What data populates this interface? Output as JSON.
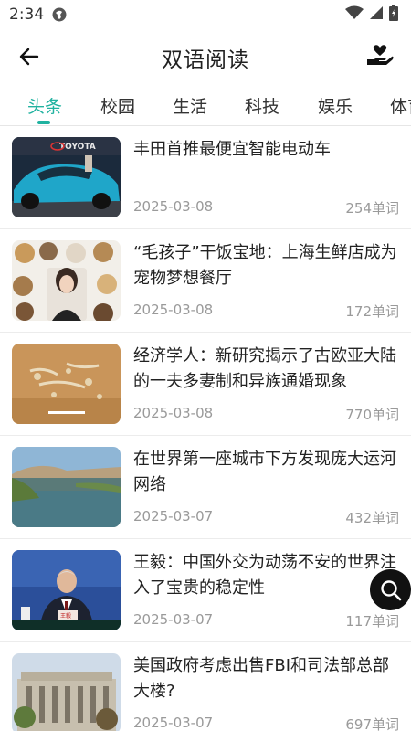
{
  "status": {
    "time": "2:34"
  },
  "header": {
    "title": "双语阅读"
  },
  "tabs": [
    {
      "label": "头条"
    },
    {
      "label": "校园"
    },
    {
      "label": "生活"
    },
    {
      "label": "科技"
    },
    {
      "label": "娱乐"
    },
    {
      "label": "体育"
    }
  ],
  "articles": [
    {
      "title": "丰田首推最便宜智能电动车",
      "date": "2025-03-08",
      "words": "254单词",
      "thumb_text": "TOYOTA"
    },
    {
      "title": "“毛孩子”干饭宝地：上海生鲜店成为宠物梦想餐厅",
      "date": "2025-03-08",
      "words": "172单词"
    },
    {
      "title": "经济学人：新研究揭示了古欧亚大陆的一夫多妻制和异族通婚现象",
      "date": "2025-03-08",
      "words": "770单词"
    },
    {
      "title": "在世界第一座城市下方发现庞大运河网络",
      "date": "2025-03-07",
      "words": "432单词"
    },
    {
      "title": "王毅：中国外交为动荡不安的世界注入了宝贵的稳定性",
      "date": "2025-03-07",
      "words": "117单词",
      "thumb_text": "王毅"
    },
    {
      "title": "美国政府考虑出售FBI和司法部总部大楼?",
      "date": "2025-03-07",
      "words": "697单词"
    }
  ],
  "colors": {
    "accent": "#20b2a0",
    "muted": "#9a9a9a"
  }
}
